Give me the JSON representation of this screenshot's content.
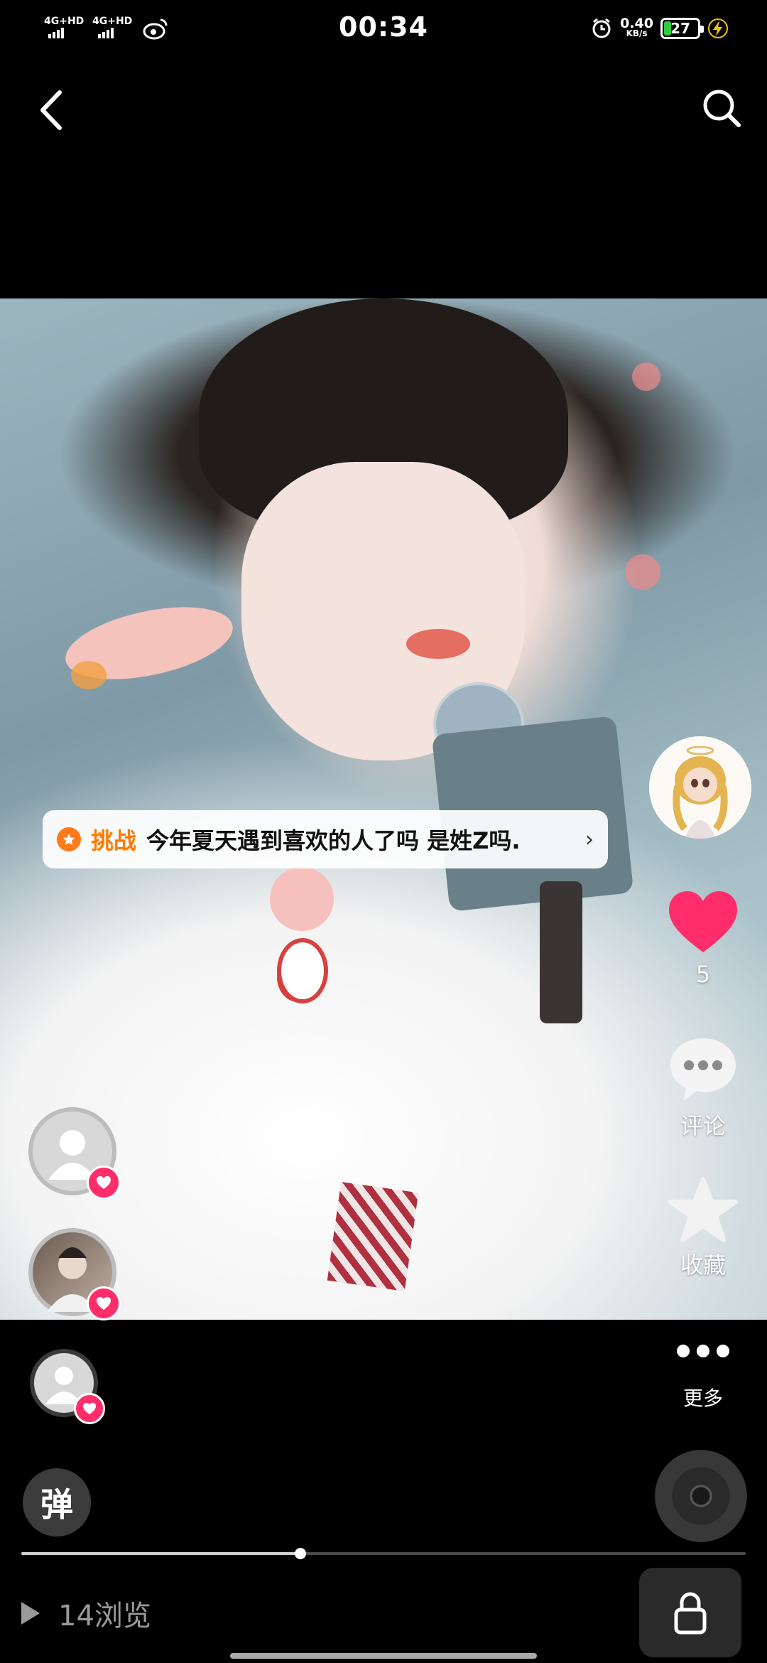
{
  "status_bar": {
    "network_1": "4G+HD",
    "network_2": "4G+HD",
    "time": "00:34",
    "speed_value": "0.40",
    "speed_unit": "KB/s",
    "battery_level": "27",
    "battery_percent": 27,
    "alarm_icon": "alarm-icon",
    "charging_icon": "charging-bolt-icon"
  },
  "header": {
    "back_icon": "chevron-left-icon",
    "search_icon": "search-icon"
  },
  "challenge": {
    "tag": "挑战",
    "text": "今年夏天遇到喜欢的人了吗 是姓Z吗.",
    "icon": "challenge-icon",
    "arrow": "›"
  },
  "actions": {
    "like_count": "5",
    "comment_label": "评论",
    "favorite_label": "收藏",
    "more_label": "更多",
    "like_color": "#ff2d6a"
  },
  "danmu": {
    "label": "弹"
  },
  "progress": {
    "fraction": 0.385
  },
  "views": {
    "text": "14浏览"
  },
  "lock": {
    "icon": "lock-icon"
  }
}
